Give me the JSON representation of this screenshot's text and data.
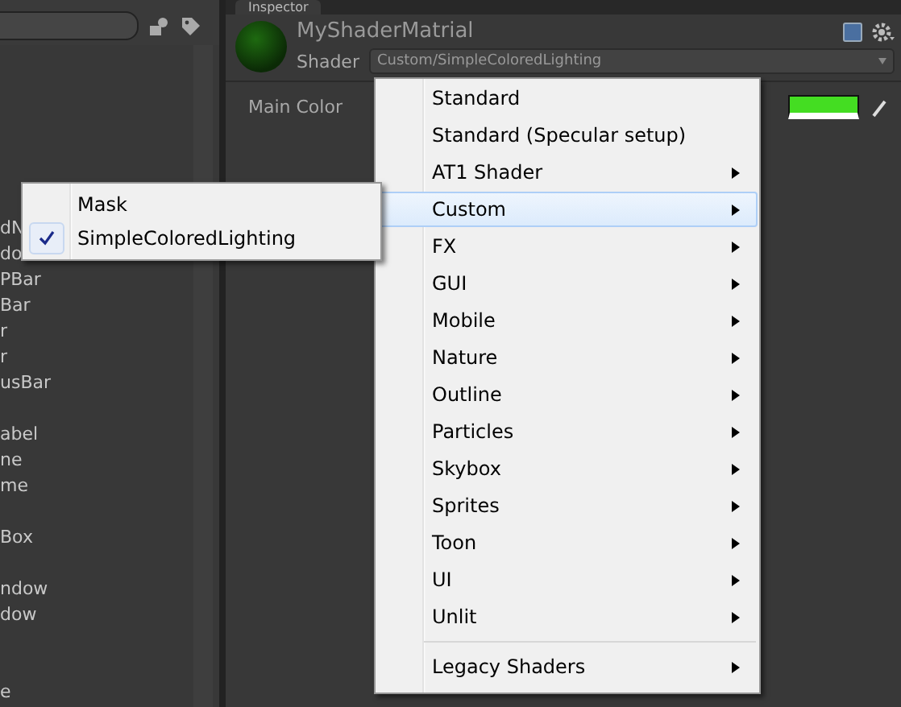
{
  "hierarchy": {
    "groups": [
      [
        "dN",
        "do",
        "PBar",
        "Bar",
        "r",
        "r",
        "usBar"
      ],
      [
        "abel",
        "ne",
        "me"
      ],
      [
        "Box"
      ],
      [
        "ndow",
        "dow"
      ],
      [
        "e"
      ]
    ]
  },
  "inspector": {
    "tab": "Inspector",
    "material_name": "MyShaderMatrial",
    "shader_label": "Shader",
    "shader_value": "Custom/SimpleColoredLighting",
    "properties": [
      {
        "label": "Main Color",
        "color": "#44dd22"
      }
    ]
  },
  "shader_menu": {
    "items": [
      {
        "kind": "item",
        "label": "Standard",
        "submenu": false,
        "selected": false
      },
      {
        "kind": "item",
        "label": "Standard (Specular setup)",
        "submenu": false,
        "selected": false
      },
      {
        "kind": "item",
        "label": "AT1 Shader",
        "submenu": true,
        "selected": false
      },
      {
        "kind": "item",
        "label": "Custom",
        "submenu": true,
        "selected": true
      },
      {
        "kind": "item",
        "label": "FX",
        "submenu": true,
        "selected": false
      },
      {
        "kind": "item",
        "label": "GUI",
        "submenu": true,
        "selected": false
      },
      {
        "kind": "item",
        "label": "Mobile",
        "submenu": true,
        "selected": false
      },
      {
        "kind": "item",
        "label": "Nature",
        "submenu": true,
        "selected": false
      },
      {
        "kind": "item",
        "label": "Outline",
        "submenu": true,
        "selected": false
      },
      {
        "kind": "item",
        "label": "Particles",
        "submenu": true,
        "selected": false
      },
      {
        "kind": "item",
        "label": "Skybox",
        "submenu": true,
        "selected": false
      },
      {
        "kind": "item",
        "label": "Sprites",
        "submenu": true,
        "selected": false
      },
      {
        "kind": "item",
        "label": "Toon",
        "submenu": true,
        "selected": false
      },
      {
        "kind": "item",
        "label": "UI",
        "submenu": true,
        "selected": false
      },
      {
        "kind": "item",
        "label": "Unlit",
        "submenu": true,
        "selected": false
      },
      {
        "kind": "separator"
      },
      {
        "kind": "item",
        "label": "Legacy Shaders",
        "submenu": true,
        "selected": false
      }
    ]
  },
  "custom_submenu": {
    "items": [
      {
        "label": "Mask",
        "checked": false
      },
      {
        "label": "SimpleColoredLighting",
        "checked": true
      }
    ]
  }
}
